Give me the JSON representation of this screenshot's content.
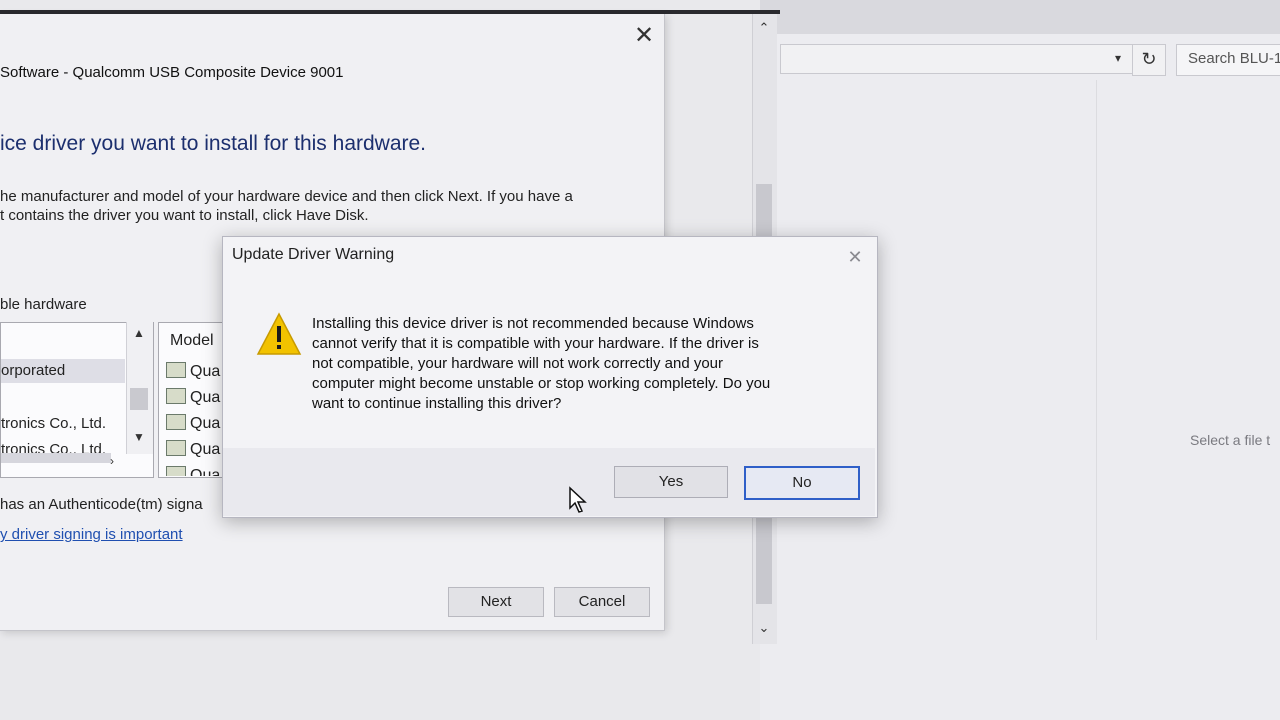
{
  "explorer": {
    "search_placeholder": "Search BLU-1",
    "preview_text": "Select a file t",
    "refresh_icon": "refresh-icon",
    "dropdown_icon": "chevron-down-icon"
  },
  "wizard": {
    "title": "Software - Qualcomm USB Composite Device 9001",
    "heading": "ice driver you want to install for this hardware.",
    "desc_line1": "he manufacturer and model of your hardware device and then click Next. If you have a",
    "desc_line2": "t contains the driver you want to install, click Have Disk.",
    "compat_label": "ble hardware",
    "manufacturers": [
      "orporated",
      "tronics Co., Ltd.",
      "tronics Co., Ltd."
    ],
    "model_header": "Model",
    "models": [
      "Qua",
      "Qua",
      "Qua",
      "Qua",
      "Qua"
    ],
    "signed_text": "has an Authenticode(tm) signa",
    "signing_link": "y driver signing is important",
    "next_label": "Next",
    "cancel_label": "Cancel"
  },
  "warning": {
    "title": "Update Driver Warning",
    "message_lines": [
      "Installing this device driver is not recommended because Windows",
      "cannot verify that it is compatible with your hardware.  If the driver is",
      "not compatible, your hardware will not work correctly and your",
      "computer might become unstable or stop working completely.  Do you",
      "want to continue installing this driver?"
    ],
    "yes_label": "Yes",
    "no_label": "No",
    "icon": "warning-icon"
  },
  "colors": {
    "heading_blue": "#1c2f6e",
    "link_blue": "#1f4fb0",
    "focus_border": "#2f5fc8",
    "warning_yellow": "#f2c200"
  }
}
